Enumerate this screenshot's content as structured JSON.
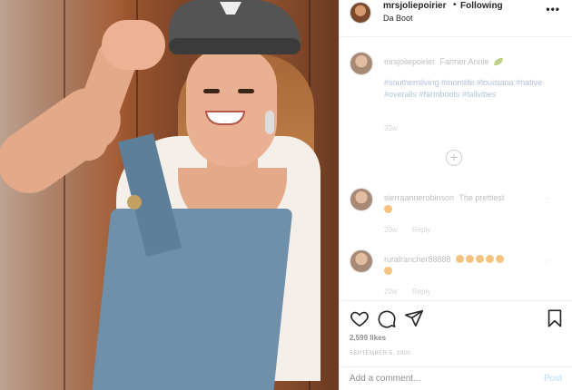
{
  "post": {
    "image_alt_subject": "woman-in-cap-and-overalls",
    "header": {
      "username": "mrsjoliepoirier",
      "separator": "•",
      "follow_status": "Following",
      "location": "Da Boot",
      "more_icon": "more-horizontal-icon"
    },
    "caption": {
      "username": "mrsjoliepoirier",
      "text": "Farmer Annie",
      "hashtags": "#southernliving #momlife #louisiana #native #overalls #farmboots #fallvibes",
      "time": "33w"
    },
    "load_more_label": "+",
    "comments": [
      {
        "username": "sierraannerobinson",
        "text": "The prettiest",
        "time": "20w",
        "reply_label": "Reply"
      },
      {
        "username": "ruralrancher88888",
        "text": "",
        "time": "20w",
        "reply_label": "Reply"
      }
    ],
    "actions": {
      "like_icon": "heart-icon",
      "comment_icon": "comment-icon",
      "share_icon": "paper-plane-icon",
      "save_icon": "bookmark-icon"
    },
    "likes_text": "2,599 likes",
    "date_text": "SEPTEMBER 5, 2020",
    "add_comment": {
      "placeholder": "Add a comment...",
      "post_label": "Post"
    },
    "colors": {
      "link_blue": "#b2dffc",
      "hashtag": "#8aa2c6",
      "text": "#262626",
      "muted": "#8e8e8e"
    }
  }
}
